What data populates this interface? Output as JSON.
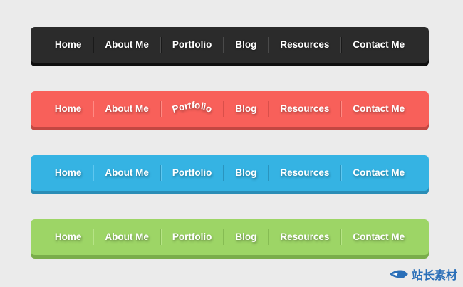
{
  "menus": [
    {
      "id": "dark",
      "items": [
        "Home",
        "About Me",
        "Portfolio",
        "Blog",
        "Resources",
        "Contact Me"
      ]
    },
    {
      "id": "red",
      "items": [
        "Home",
        "About Me",
        "Portfolio",
        "Blog",
        "Resources",
        "Contact Me"
      ]
    },
    {
      "id": "blue",
      "items": [
        "Home",
        "About Me",
        "Portfolio",
        "Blog",
        "Resources",
        "Contact Me"
      ]
    },
    {
      "id": "green",
      "items": [
        "Home",
        "About Me",
        "Portfolio",
        "Blog",
        "Resources",
        "Contact Me"
      ]
    }
  ],
  "active_hover": {
    "menu": "red",
    "item": "Portfolio"
  },
  "colors": {
    "page_bg": "#ebebeb",
    "dark": "#2b2b2b",
    "red": "#f8605a",
    "blue": "#35b3e3",
    "green": "#9dd566",
    "text": "#ffffff"
  },
  "watermark": {
    "text": "站长素材",
    "icon": "logo-swoosh-icon"
  }
}
